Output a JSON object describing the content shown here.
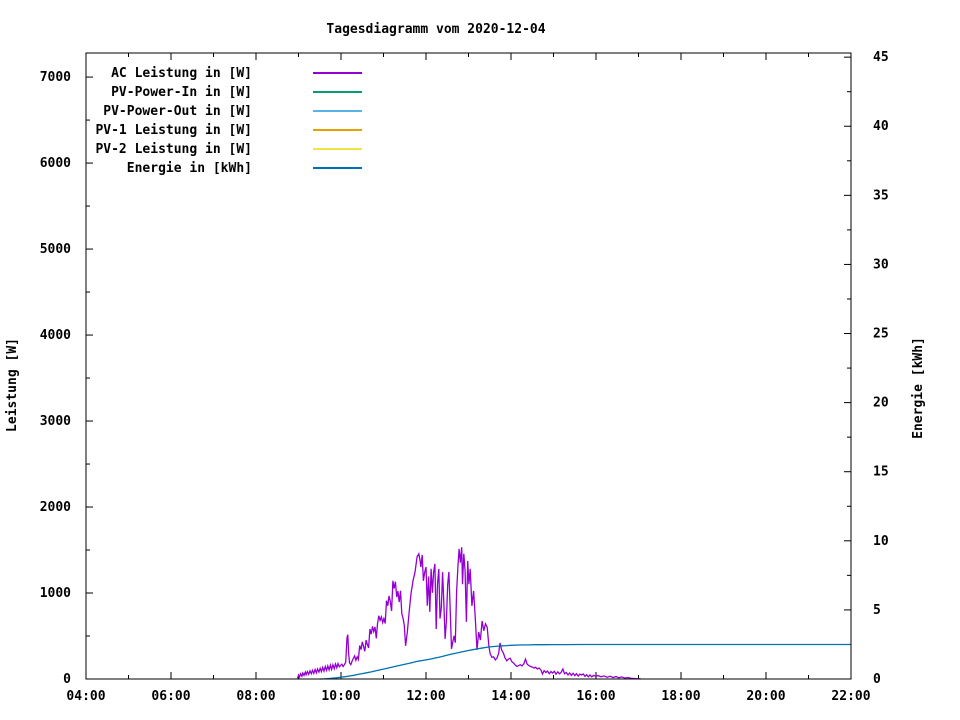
{
  "chart_data": {
    "type": "line",
    "title": "Tagesdiagramm vom 2020-12-04",
    "xlabel": "",
    "ylabel": "Leistung [W]",
    "y2label": "Energie [kWh]",
    "grid": false,
    "legend_position": "top-left-inside",
    "x_axis": {
      "min": 4,
      "max": 22,
      "major_tick_hours": [
        4,
        6,
        8,
        10,
        12,
        14,
        16,
        18,
        20,
        22
      ],
      "major_tick_labels": [
        "04:00",
        "06:00",
        "08:00",
        "10:00",
        "12:00",
        "14:00",
        "16:00",
        "18:00",
        "20:00",
        "22:00"
      ],
      "minor_tick_hours": [
        5,
        7,
        9,
        11,
        13,
        15,
        17,
        19,
        21
      ]
    },
    "y_axis": {
      "label": "Leistung [W]",
      "min": 0,
      "max": 7280,
      "major_ticks": [
        0,
        1000,
        2000,
        3000,
        4000,
        5000,
        6000,
        7000
      ],
      "major_tick_labels": [
        "0",
        "1000",
        "2000",
        "3000",
        "4000",
        "5000",
        "6000",
        "7000"
      ],
      "minor_tick_step": 500
    },
    "y2_axis": {
      "label": "Energie [kWh]",
      "min": 0,
      "max": 45.3,
      "major_ticks": [
        0,
        5,
        10,
        15,
        20,
        25,
        30,
        35,
        40,
        45
      ],
      "major_tick_labels": [
        "0",
        "5",
        "10",
        "15",
        "20",
        "25",
        "30",
        "35",
        "40",
        "45"
      ],
      "minor_tick_step": 2.5
    },
    "series": [
      {
        "name": "AC Leistung in [W]",
        "color": "#9400d3",
        "axis": "y1",
        "points": [
          [
            8.98,
            8
          ],
          [
            9.0,
            45
          ],
          [
            9.02,
            22
          ],
          [
            9.05,
            60
          ],
          [
            9.08,
            32
          ],
          [
            9.1,
            70
          ],
          [
            9.13,
            42
          ],
          [
            9.16,
            80
          ],
          [
            9.18,
            50
          ],
          [
            9.21,
            86
          ],
          [
            9.24,
            55
          ],
          [
            9.27,
            95
          ],
          [
            9.3,
            62
          ],
          [
            9.33,
            100
          ],
          [
            9.36,
            66
          ],
          [
            9.39,
            110
          ],
          [
            9.42,
            72
          ],
          [
            9.45,
            116
          ],
          [
            9.48,
            80
          ],
          [
            9.51,
            125
          ],
          [
            9.54,
            86
          ],
          [
            9.57,
            135
          ],
          [
            9.6,
            92
          ],
          [
            9.63,
            145
          ],
          [
            9.66,
            100
          ],
          [
            9.69,
            152
          ],
          [
            9.72,
            106
          ],
          [
            9.75,
            160
          ],
          [
            9.78,
            112
          ],
          [
            9.81,
            166
          ],
          [
            9.84,
            120
          ],
          [
            9.87,
            175
          ],
          [
            9.9,
            130
          ],
          [
            9.93,
            180
          ],
          [
            9.96,
            142
          ],
          [
            9.99,
            158
          ],
          [
            10.02,
            172
          ],
          [
            10.05,
            145
          ],
          [
            10.08,
            166
          ],
          [
            10.11,
            195
          ],
          [
            10.14,
            480
          ],
          [
            10.16,
            515
          ],
          [
            10.18,
            305
          ],
          [
            10.2,
            188
          ],
          [
            10.23,
            168
          ],
          [
            10.26,
            205
          ],
          [
            10.29,
            238
          ],
          [
            10.32,
            268
          ],
          [
            10.35,
            218
          ],
          [
            10.38,
            258
          ],
          [
            10.41,
            228
          ],
          [
            10.44,
            388
          ],
          [
            10.47,
            342
          ],
          [
            10.5,
            432
          ],
          [
            10.53,
            382
          ],
          [
            10.56,
            322
          ],
          [
            10.59,
            452
          ],
          [
            10.62,
            402
          ],
          [
            10.65,
            362
          ],
          [
            10.68,
            582
          ],
          [
            10.71,
            522
          ],
          [
            10.74,
            612
          ],
          [
            10.77,
            552
          ],
          [
            10.8,
            606
          ],
          [
            10.83,
            472
          ],
          [
            10.86,
            642
          ],
          [
            10.89,
            736
          ],
          [
            10.92,
            682
          ],
          [
            10.95,
            722
          ],
          [
            10.98,
            656
          ],
          [
            11.01,
            702
          ],
          [
            11.04,
            646
          ],
          [
            11.07,
            912
          ],
          [
            11.1,
            852
          ],
          [
            11.13,
            966
          ],
          [
            11.16,
            902
          ],
          [
            11.19,
            792
          ],
          [
            11.22,
            1142
          ],
          [
            11.25,
            1052
          ],
          [
            11.28,
            1132
          ],
          [
            11.31,
            952
          ],
          [
            11.34,
            1022
          ],
          [
            11.37,
            896
          ],
          [
            11.4,
            1026
          ],
          [
            11.43,
            762
          ],
          [
            11.46,
            702
          ],
          [
            11.49,
            622
          ],
          [
            11.52,
            386
          ],
          [
            11.56,
            542
          ],
          [
            11.6,
            762
          ],
          [
            11.65,
            1002
          ],
          [
            11.7,
            1152
          ],
          [
            11.74,
            1242
          ],
          [
            11.79,
            1422
          ],
          [
            11.83,
            1456
          ],
          [
            11.86,
            1382
          ],
          [
            11.88,
            1302
          ],
          [
            11.91,
            1442
          ],
          [
            11.94,
            1142
          ],
          [
            11.97,
            1242
          ],
          [
            12.0,
            1302
          ],
          [
            12.03,
            852
          ],
          [
            12.06,
            1192
          ],
          [
            12.09,
            782
          ],
          [
            12.12,
            1282
          ],
          [
            12.15,
            1002
          ],
          [
            12.18,
            1242
          ],
          [
            12.21,
            1338
          ],
          [
            12.24,
            582
          ],
          [
            12.27,
            1102
          ],
          [
            12.3,
            1280
          ],
          [
            12.33,
            702
          ],
          [
            12.36,
            822
          ],
          [
            12.39,
            1242
          ],
          [
            12.42,
            862
          ],
          [
            12.45,
            466
          ],
          [
            12.48,
            675
          ],
          [
            12.51,
            1102
          ],
          [
            12.54,
            1245
          ],
          [
            12.57,
            802
          ],
          [
            12.6,
            350
          ],
          [
            12.63,
            432
          ],
          [
            12.66,
            502
          ],
          [
            12.69,
            422
          ],
          [
            12.72,
            1013
          ],
          [
            12.75,
            1302
          ],
          [
            12.78,
            1513
          ],
          [
            12.81,
            1352
          ],
          [
            12.84,
            1532
          ],
          [
            12.86,
            1102
          ],
          [
            12.89,
            1456
          ],
          [
            12.92,
            1252
          ],
          [
            12.95,
            664
          ],
          [
            12.98,
            1373
          ],
          [
            13.01,
            1102
          ],
          [
            13.04,
            1280
          ],
          [
            13.08,
            850
          ],
          [
            13.12,
            1024
          ],
          [
            13.16,
            702
          ],
          [
            13.2,
            338
          ],
          [
            13.24,
            547
          ],
          [
            13.28,
            452
          ],
          [
            13.32,
            675
          ],
          [
            13.36,
            562
          ],
          [
            13.4,
            642
          ],
          [
            13.44,
            602
          ],
          [
            13.48,
            382
          ],
          [
            13.51,
            292
          ],
          [
            13.55,
            252
          ],
          [
            13.59,
            257
          ],
          [
            13.63,
            222
          ],
          [
            13.67,
            242
          ],
          [
            13.71,
            302
          ],
          [
            13.74,
            420
          ],
          [
            13.78,
            338
          ],
          [
            13.82,
            302
          ],
          [
            13.86,
            245
          ],
          [
            13.9,
            212
          ],
          [
            13.94,
            232
          ],
          [
            13.98,
            242
          ],
          [
            14.02,
            202
          ],
          [
            14.06,
            186
          ],
          [
            14.1,
            162
          ],
          [
            14.14,
            146
          ],
          [
            14.18,
            156
          ],
          [
            14.22,
            166
          ],
          [
            14.26,
            152
          ],
          [
            14.3,
            176
          ],
          [
            14.34,
            232
          ],
          [
            14.38,
            172
          ],
          [
            14.42,
            156
          ],
          [
            14.46,
            146
          ],
          [
            14.5,
            138
          ],
          [
            14.54,
            128
          ],
          [
            14.58,
            136
          ],
          [
            14.62,
            118
          ],
          [
            14.66,
            128
          ],
          [
            14.7,
            108
          ],
          [
            14.74,
            58
          ],
          [
            14.78,
            98
          ],
          [
            14.82,
            76
          ],
          [
            14.86,
            92
          ],
          [
            14.9,
            62
          ],
          [
            14.94,
            86
          ],
          [
            14.98,
            70
          ],
          [
            15.02,
            90
          ],
          [
            15.06,
            56
          ],
          [
            15.1,
            82
          ],
          [
            15.14,
            60
          ],
          [
            15.18,
            78
          ],
          [
            15.22,
            116
          ],
          [
            15.26,
            62
          ],
          [
            15.3,
            76
          ],
          [
            15.34,
            48
          ],
          [
            15.38,
            70
          ],
          [
            15.42,
            42
          ],
          [
            15.46,
            66
          ],
          [
            15.5,
            38
          ],
          [
            15.54,
            62
          ],
          [
            15.58,
            34
          ],
          [
            15.62,
            56
          ],
          [
            15.66,
            46
          ],
          [
            15.7,
            58
          ],
          [
            15.74,
            30
          ],
          [
            15.78,
            50
          ],
          [
            15.82,
            26
          ],
          [
            15.86,
            46
          ],
          [
            15.9,
            24
          ],
          [
            15.94,
            42
          ],
          [
            15.98,
            34
          ],
          [
            16.05,
            40
          ],
          [
            16.12,
            26
          ],
          [
            16.19,
            36
          ],
          [
            16.26,
            20
          ],
          [
            16.33,
            32
          ],
          [
            16.4,
            18
          ],
          [
            16.47,
            28
          ],
          [
            16.54,
            14
          ],
          [
            16.61,
            24
          ],
          [
            16.68,
            10
          ],
          [
            16.75,
            18
          ],
          [
            16.82,
            8
          ],
          [
            16.89,
            6
          ],
          [
            16.96,
            4
          ],
          [
            17.05,
            2
          ]
        ]
      },
      {
        "name": "PV-Power-In in [W]",
        "color": "#009e73",
        "axis": "y1",
        "points": []
      },
      {
        "name": "PV-Power-Out in [W]",
        "color": "#56b4e9",
        "axis": "y1",
        "points": []
      },
      {
        "name": "PV-1 Leistung in [W]",
        "color": "#e69f00",
        "axis": "y1",
        "points": []
      },
      {
        "name": "PV-2 Leistung in [W]",
        "color": "#f0e442",
        "axis": "y1",
        "points": []
      },
      {
        "name": "Energie in [kWh]",
        "color": "#0072b2",
        "axis": "y2",
        "points": [
          [
            9.5,
            0
          ],
          [
            9.6,
            0.01
          ],
          [
            9.7,
            0.03
          ],
          [
            9.8,
            0.06
          ],
          [
            9.9,
            0.09
          ],
          [
            10.0,
            0.13
          ],
          [
            10.1,
            0.17
          ],
          [
            10.2,
            0.22
          ],
          [
            10.3,
            0.27
          ],
          [
            10.4,
            0.33
          ],
          [
            10.5,
            0.39
          ],
          [
            10.6,
            0.45
          ],
          [
            10.7,
            0.51
          ],
          [
            10.8,
            0.58
          ],
          [
            10.9,
            0.65
          ],
          [
            11.0,
            0.72
          ],
          [
            11.1,
            0.79
          ],
          [
            11.2,
            0.86
          ],
          [
            11.3,
            0.93
          ],
          [
            11.4,
            1.0
          ],
          [
            11.5,
            1.07
          ],
          [
            11.6,
            1.13
          ],
          [
            11.7,
            1.2
          ],
          [
            11.8,
            1.28
          ],
          [
            11.9,
            1.33
          ],
          [
            12.0,
            1.38
          ],
          [
            12.1,
            1.44
          ],
          [
            12.2,
            1.51
          ],
          [
            12.3,
            1.58
          ],
          [
            12.4,
            1.65
          ],
          [
            12.5,
            1.73
          ],
          [
            12.6,
            1.8
          ],
          [
            12.7,
            1.87
          ],
          [
            12.8,
            1.94
          ],
          [
            12.9,
            2.0
          ],
          [
            13.0,
            2.06
          ],
          [
            13.1,
            2.12
          ],
          [
            13.2,
            2.18
          ],
          [
            13.3,
            2.23
          ],
          [
            13.4,
            2.28
          ],
          [
            13.5,
            2.32
          ],
          [
            13.6,
            2.35
          ],
          [
            13.7,
            2.38
          ],
          [
            13.8,
            2.4
          ],
          [
            13.9,
            2.42
          ],
          [
            14.0,
            2.44
          ],
          [
            14.2,
            2.46
          ],
          [
            14.4,
            2.47
          ],
          [
            14.6,
            2.48
          ],
          [
            14.8,
            2.48
          ],
          [
            15.0,
            2.49
          ],
          [
            15.3,
            2.49
          ],
          [
            15.6,
            2.5
          ],
          [
            16.0,
            2.5
          ],
          [
            22.0,
            2.5
          ]
        ]
      }
    ]
  }
}
